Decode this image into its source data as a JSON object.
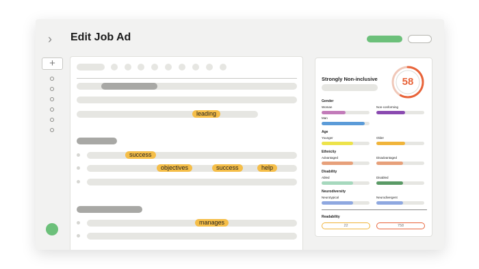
{
  "header": {
    "title": "Edit Job Ad"
  },
  "editor": {
    "highlights": [
      "leading",
      "success",
      "objectives",
      "success",
      "help",
      "manages"
    ]
  },
  "analysis": {
    "verdict": "Strongly Non-inclusive",
    "score": "58",
    "accent_color": "#e8643a",
    "sections": [
      {
        "name": "Gender",
        "rows": [
          {
            "left_label": "Woman",
            "left_level": 0.5,
            "left_color": "#c27bb9",
            "right_label": "Non-conforming",
            "right_level": 0.6,
            "right_color": "#8a4ab0"
          },
          {
            "left_label": "Man",
            "left_level": 0.9,
            "left_color": "#5b9bd8"
          }
        ]
      },
      {
        "name": "Age",
        "rows": [
          {
            "left_label": "Younger",
            "left_level": 0.65,
            "left_color": "#ede34a",
            "right_label": "Older",
            "right_level": 0.6,
            "right_color": "#f0b43a"
          }
        ]
      },
      {
        "name": "Ethnicity",
        "rows": [
          {
            "left_label": "Advantaged",
            "left_level": 0.65,
            "left_color": "#e7a07a",
            "right_label": "Disadvantaged",
            "right_level": 0.55,
            "right_color": "#e7a07a"
          }
        ]
      },
      {
        "name": "Disability",
        "rows": [
          {
            "left_label": "Abled",
            "left_level": 0.65,
            "left_color": "#a6d8bd",
            "right_label": "Disabled",
            "right_level": 0.55,
            "right_color": "#5a9a66"
          }
        ]
      },
      {
        "name": "Neurodiversity",
        "rows": [
          {
            "left_label": "Neurotypical",
            "left_level": 0.65,
            "left_color": "#8fa8e0",
            "right_label": "Neurodivergent",
            "right_level": 0.55,
            "right_color": "#8fa8e0"
          }
        ]
      }
    ],
    "readability": {
      "label": "Readability",
      "left_value": "22",
      "left_color": "#f0b43a",
      "right_value": "758",
      "right_color": "#e8643a"
    }
  }
}
